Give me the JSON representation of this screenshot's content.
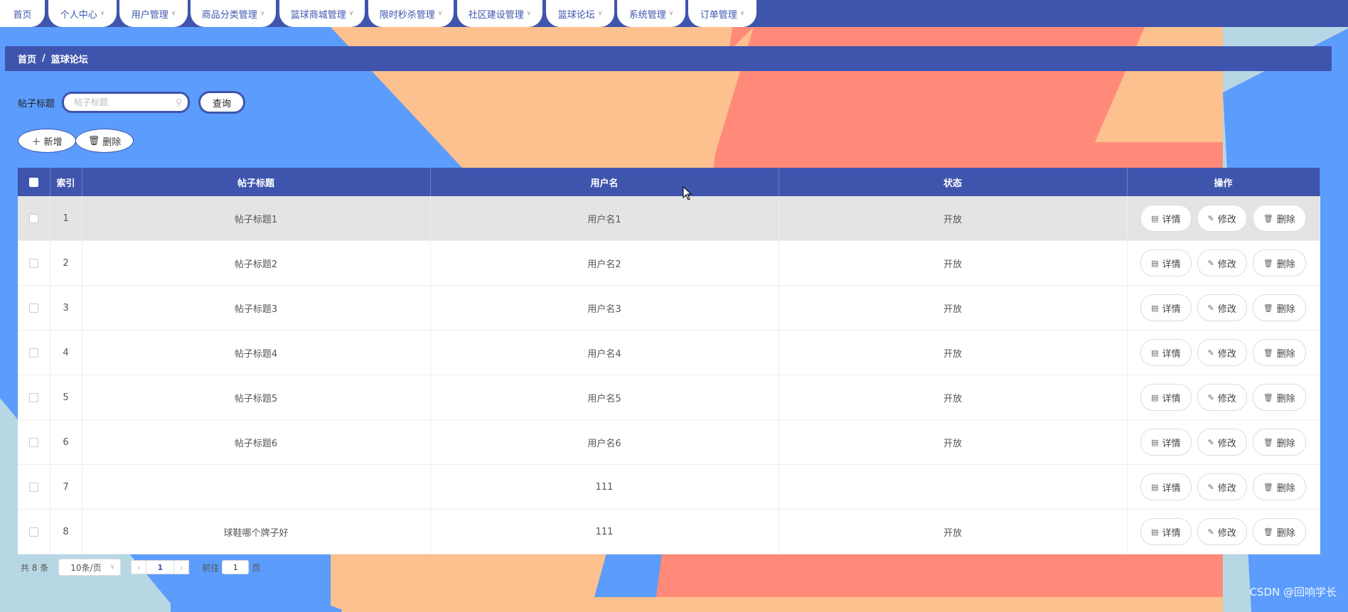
{
  "colors": {
    "primary": "#3f55ad",
    "bg_blue": "#5b9cfc",
    "bg_peach": "#fdc08f",
    "bg_coral": "#ff8a7a",
    "bg_light": "#b8d7e4"
  },
  "nav": {
    "items": [
      {
        "label": "首页",
        "dropdown": false
      },
      {
        "label": "个人中心",
        "dropdown": true
      },
      {
        "label": "用户管理",
        "dropdown": true
      },
      {
        "label": "商品分类管理",
        "dropdown": true
      },
      {
        "label": "篮球商城管理",
        "dropdown": true
      },
      {
        "label": "限时秒杀管理",
        "dropdown": true
      },
      {
        "label": "社区建设管理",
        "dropdown": true
      },
      {
        "label": "篮球论坛",
        "dropdown": true
      },
      {
        "label": "系统管理",
        "dropdown": true
      },
      {
        "label": "订单管理",
        "dropdown": true
      }
    ]
  },
  "breadcrumb": {
    "home": "首页",
    "sep": "/",
    "current": "篮球论坛"
  },
  "search": {
    "label": "帖子标题",
    "placeholder": "帖子标题",
    "value": "",
    "query_button": "查询"
  },
  "actions": {
    "add": "新增",
    "delete": "删除"
  },
  "table": {
    "headers": {
      "index": "索引",
      "title": "帖子标题",
      "username": "用户名",
      "status": "状态",
      "ops": "操作"
    },
    "rows": [
      {
        "index": "1",
        "title": "帖子标题1",
        "username": "用户名1",
        "status": "开放"
      },
      {
        "index": "2",
        "title": "帖子标题2",
        "username": "用户名2",
        "status": "开放"
      },
      {
        "index": "3",
        "title": "帖子标题3",
        "username": "用户名3",
        "status": "开放"
      },
      {
        "index": "4",
        "title": "帖子标题4",
        "username": "用户名4",
        "status": "开放"
      },
      {
        "index": "5",
        "title": "帖子标题5",
        "username": "用户名5",
        "status": "开放"
      },
      {
        "index": "6",
        "title": "帖子标题6",
        "username": "用户名6",
        "status": "开放"
      },
      {
        "index": "7",
        "title": "",
        "username": "111",
        "status": ""
      },
      {
        "index": "8",
        "title": "球鞋哪个牌子好",
        "username": "111",
        "status": "开放"
      }
    ],
    "row_actions": {
      "detail": "详情",
      "edit": "修改",
      "delete": "删除"
    }
  },
  "pagination": {
    "total": "共 8 条",
    "page_size": "10条/页",
    "current_page": "1",
    "goto_prefix": "前往",
    "goto_value": "1",
    "goto_suffix": "页"
  },
  "watermark": "CSDN @回响学长"
}
